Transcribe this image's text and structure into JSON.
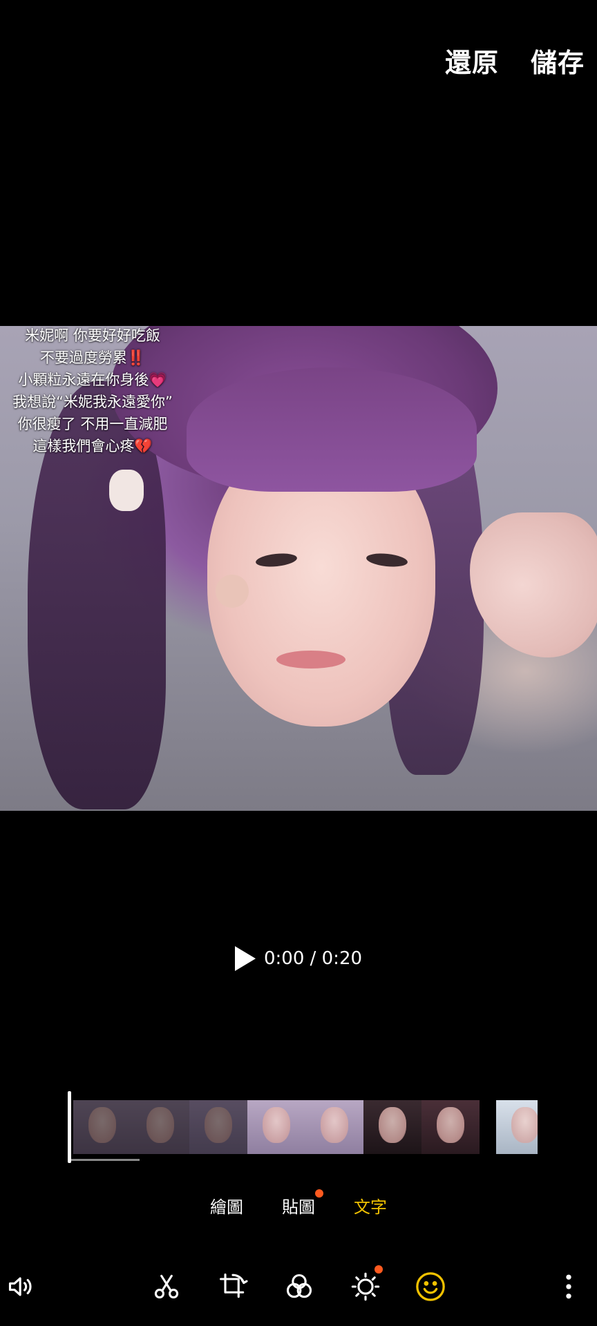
{
  "header": {
    "revert_label": "還原",
    "save_label": "儲存"
  },
  "preview": {
    "caption_lines": [
      "米妮啊 你要好好吃飯",
      "不要過度勞累‼️",
      "小顆粒永遠在你身後💗",
      "我想說“米妮我永遠愛你”",
      "你很瘦了 不用一直減肥",
      "這樣我們會心疼💔"
    ]
  },
  "player": {
    "time_text": "0:00 / 0:20"
  },
  "tabs": [
    {
      "label": "繪圖",
      "active": false,
      "badge": false
    },
    {
      "label": "貼圖",
      "active": false,
      "badge": true
    },
    {
      "label": "文字",
      "active": true,
      "badge": false
    }
  ],
  "toolbar": {
    "icons": [
      "volume-icon",
      "scissors-icon",
      "crop-rotate-icon",
      "filter-icon",
      "brightness-icon",
      "sticker-smiley-icon",
      "more-vertical-icon"
    ],
    "accent_color": "#f2c200",
    "badge_color": "#ff5a1f"
  }
}
